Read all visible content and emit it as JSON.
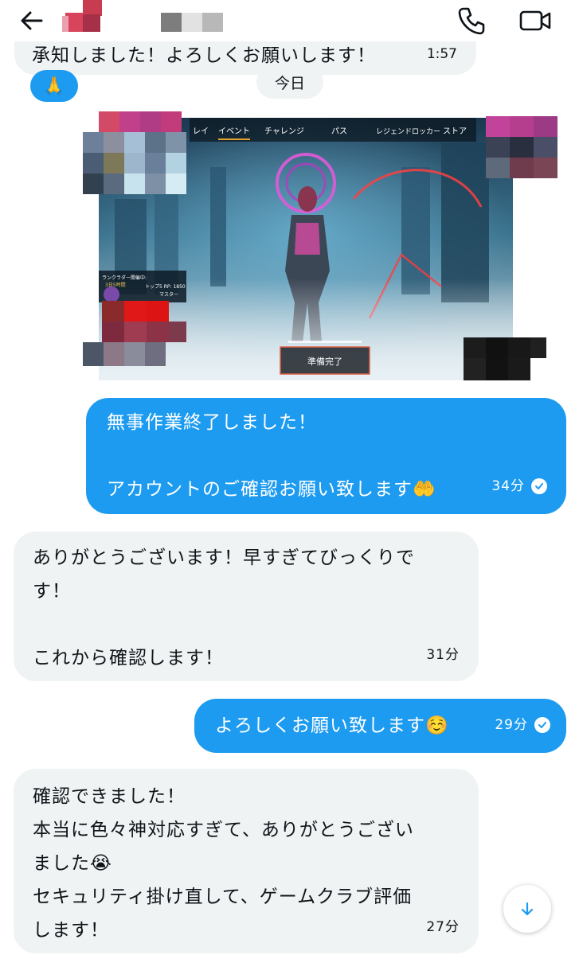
{
  "header": {
    "back_icon": "arrow-left-icon",
    "call_icon": "phone-icon",
    "video_icon": "video-camera-icon"
  },
  "previous_message": {
    "text": "承知しました！よろしくお願いします！",
    "time": "1:57",
    "reaction": "🙏"
  },
  "date_separator": "今日",
  "image_message": {
    "game_tabs": [
      "レイ",
      "イベント",
      "チャレンジ",
      "パス",
      "レジェンドロッカー",
      "ストア"
    ],
    "rank_label": "ランクラダー開催中:",
    "rank_timer": "3日5時間",
    "rank_points": "トップ5 RP: 1850",
    "rank_tier": "マスター",
    "ready_button": "準備完了"
  },
  "messages": [
    {
      "direction": "sent",
      "lines": [
        "無事作業終了しました！",
        "",
        "アカウントのご確認お願い致します🤲"
      ],
      "time": "34分",
      "read": true
    },
    {
      "direction": "received",
      "lines": [
        "ありがとうございます！早すぎてびっくりで",
        "す！",
        "",
        "これから確認します！"
      ],
      "time": "31分"
    },
    {
      "direction": "sent",
      "lines": [
        "よろしくお願い致します☺️"
      ],
      "time": "29分",
      "read": true
    },
    {
      "direction": "received",
      "lines": [
        "確認できました！",
        "本当に色々神対応すぎて、ありがとうござい",
        "ました😭",
        "セキュリティ掛け直して、ゲームクラブ評価",
        "します！"
      ],
      "time": "27分"
    }
  ],
  "scroll_down_icon": "arrow-down-icon",
  "colors": {
    "sent_bubble": "#1d9bf0",
    "received_bubble": "#eff3f4",
    "text": "#0f1419"
  }
}
